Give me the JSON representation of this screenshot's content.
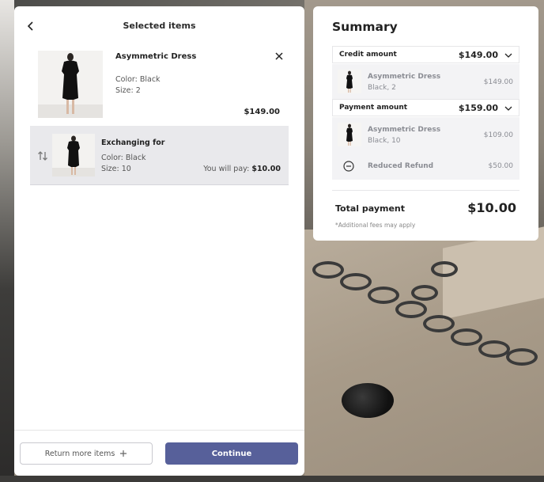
{
  "header": {
    "title": "Selected items"
  },
  "selected_item": {
    "name": "Asymmetric Dress",
    "color": "Color: Black",
    "size": "Size: 2",
    "price": "$149.00",
    "image_icon": "black-dress-photo"
  },
  "exchange": {
    "title": "Exchanging for",
    "color": "Color: Black",
    "size": "Size: 10",
    "pay_label": "You will pay:",
    "pay_amount": "$10.00",
    "image_icon": "black-dress-photo"
  },
  "footer": {
    "return_label": "Return more items",
    "continue_label": "Continue"
  },
  "summary": {
    "title": "Summary",
    "credit": {
      "label": "Credit amount",
      "amount": "$149.00",
      "item": {
        "name": "Asymmetric Dress",
        "variant": "Black, 2",
        "price": "$149.00"
      }
    },
    "payment": {
      "label": "Payment amount",
      "amount": "$159.00",
      "item": {
        "name": "Asymmetric Dress",
        "variant": "Black, 10",
        "price": "$109.00"
      },
      "refund": {
        "label": "Reduced Refund",
        "price": "$50.00"
      }
    },
    "total_label": "Total payment",
    "total_amount": "$10.00",
    "fees_note": "*Additional fees may apply"
  },
  "colors": {
    "accent": "#57609a",
    "muted_text": "#8a8c93",
    "exchange_bg": "#e9e9ec"
  }
}
